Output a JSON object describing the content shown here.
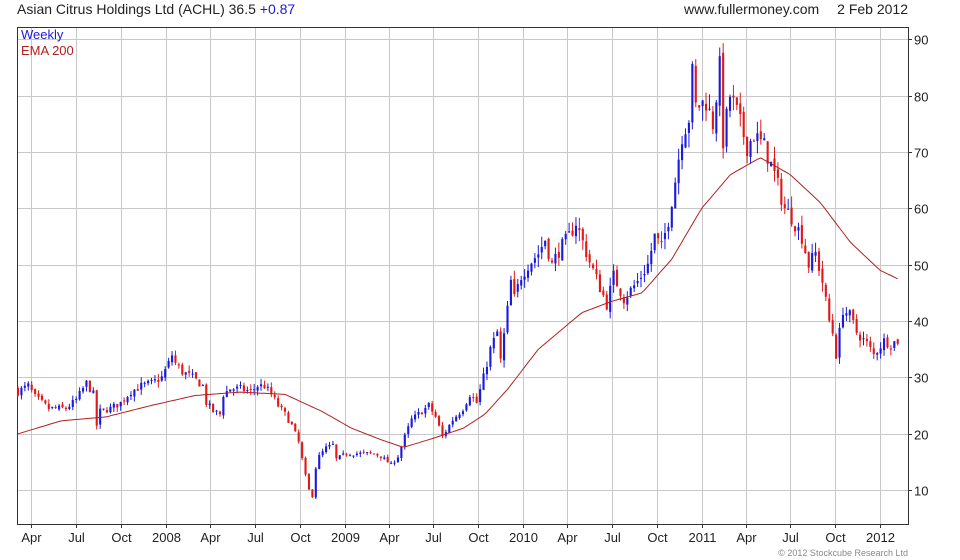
{
  "header": {
    "instrument": "Asian Citrus Holdings Ltd (ACHL)",
    "price": "36.5",
    "change": "+0.87",
    "source": "www.fullermoney.com",
    "date": "2 Feb 2012"
  },
  "copyright": "© 2012 Stockcube Research Ltd",
  "colors": {
    "up": "#1a1adb",
    "down": "#e01818",
    "ema": "#b02020",
    "grid": "#c8c8c8",
    "axis": "#333333"
  },
  "chart_data": {
    "type": "candlestick",
    "title": "Asian Citrus Holdings Ltd (ACHL)",
    "frequency": "Weekly",
    "overlay": "EMA 200",
    "ylim": [
      4,
      92
    ],
    "yticks": [
      10,
      20,
      30,
      40,
      50,
      60,
      70,
      80,
      90
    ],
    "y_axis_side": "right",
    "grid": true,
    "legend_position": "top-left",
    "xlim": [
      "2007-03-05",
      "2012-02-27"
    ],
    "xticks": [
      {
        "date": "2007-04-01",
        "label": "Apr"
      },
      {
        "date": "2007-07-01",
        "label": "Jul"
      },
      {
        "date": "2007-10-01",
        "label": "Oct"
      },
      {
        "date": "2008-01-01",
        "label": "2008"
      },
      {
        "date": "2008-04-01",
        "label": "Apr"
      },
      {
        "date": "2008-07-01",
        "label": "Jul"
      },
      {
        "date": "2008-10-01",
        "label": "Oct"
      },
      {
        "date": "2009-01-01",
        "label": "2009"
      },
      {
        "date": "2009-04-01",
        "label": "Apr"
      },
      {
        "date": "2009-07-01",
        "label": "Jul"
      },
      {
        "date": "2009-10-01",
        "label": "Oct"
      },
      {
        "date": "2010-01-01",
        "label": "2010"
      },
      {
        "date": "2010-04-01",
        "label": "Apr"
      },
      {
        "date": "2010-07-01",
        "label": "Jul"
      },
      {
        "date": "2010-10-01",
        "label": "Oct"
      },
      {
        "date": "2011-01-01",
        "label": "2011"
      },
      {
        "date": "2011-04-01",
        "label": "Apr"
      },
      {
        "date": "2011-07-01",
        "label": "Jul"
      },
      {
        "date": "2011-10-01",
        "label": "Oct"
      },
      {
        "date": "2012-01-01",
        "label": "2012"
      }
    ],
    "close_anchors": [
      [
        "2007-03-05",
        27.5
      ],
      [
        "2007-03-26",
        28.5
      ],
      [
        "2007-04-09",
        26.5
      ],
      [
        "2007-04-23",
        25.5
      ],
      [
        "2007-05-07",
        24.5
      ],
      [
        "2007-05-21",
        24.5
      ],
      [
        "2007-06-11",
        24.5
      ],
      [
        "2007-07-02",
        26.0
      ],
      [
        "2007-07-16",
        28.0
      ],
      [
        "2007-07-23",
        29.0
      ],
      [
        "2007-08-06",
        27.0
      ],
      [
        "2007-08-13",
        21.5
      ],
      [
        "2007-08-20",
        24.0
      ],
      [
        "2007-09-10",
        24.5
      ],
      [
        "2007-10-01",
        25.5
      ],
      [
        "2007-10-22",
        27.5
      ],
      [
        "2007-11-12",
        28.5
      ],
      [
        "2007-12-03",
        29.0
      ],
      [
        "2007-12-24",
        30.0
      ],
      [
        "2008-01-07",
        32.5
      ],
      [
        "2008-01-14",
        34.0
      ],
      [
        "2008-01-21",
        32.5
      ],
      [
        "2008-02-04",
        31.0
      ],
      [
        "2008-02-25",
        30.0
      ],
      [
        "2008-03-17",
        28.5
      ],
      [
        "2008-03-24",
        25.5
      ],
      [
        "2008-04-07",
        24.0
      ],
      [
        "2008-04-21",
        23.5
      ],
      [
        "2008-04-28",
        27.0
      ],
      [
        "2008-05-12",
        28.0
      ],
      [
        "2008-06-02",
        28.0
      ],
      [
        "2008-06-23",
        27.5
      ],
      [
        "2008-07-07",
        28.5
      ],
      [
        "2008-07-21",
        28.5
      ],
      [
        "2008-08-04",
        27.0
      ],
      [
        "2008-08-18",
        25.0
      ],
      [
        "2008-09-01",
        23.5
      ],
      [
        "2008-09-15",
        21.5
      ],
      [
        "2008-09-29",
        18.5
      ],
      [
        "2008-10-13",
        12.5
      ],
      [
        "2008-10-20",
        10.0
      ],
      [
        "2008-10-27",
        9.0
      ],
      [
        "2008-11-03",
        14.0
      ],
      [
        "2008-11-10",
        16.0
      ],
      [
        "2008-11-24",
        17.5
      ],
      [
        "2008-12-08",
        18.0
      ],
      [
        "2008-12-15",
        15.5
      ],
      [
        "2009-01-05",
        16.5
      ],
      [
        "2009-02-02",
        16.5
      ],
      [
        "2009-03-02",
        16.5
      ],
      [
        "2009-03-16",
        16.0
      ],
      [
        "2009-04-06",
        14.5
      ],
      [
        "2009-04-20",
        16.0
      ],
      [
        "2009-05-04",
        19.5
      ],
      [
        "2009-05-18",
        22.5
      ],
      [
        "2009-06-08",
        24.0
      ],
      [
        "2009-06-22",
        25.0
      ],
      [
        "2009-07-06",
        23.0
      ],
      [
        "2009-07-20",
        19.5
      ],
      [
        "2009-08-10",
        22.5
      ],
      [
        "2009-08-31",
        24.5
      ],
      [
        "2009-09-14",
        27.0
      ],
      [
        "2009-09-28",
        25.5
      ],
      [
        "2009-10-12",
        30.0
      ],
      [
        "2009-10-26",
        35.0
      ],
      [
        "2009-11-09",
        38.0
      ],
      [
        "2009-11-16",
        33.0
      ],
      [
        "2009-11-30",
        42.0
      ],
      [
        "2009-12-07",
        47.0
      ],
      [
        "2009-12-14",
        44.0
      ],
      [
        "2009-12-28",
        48.0
      ],
      [
        "2010-01-11",
        50.0
      ],
      [
        "2010-02-01",
        52.0
      ],
      [
        "2010-02-15",
        54.5
      ],
      [
        "2010-03-01",
        50.0
      ],
      [
        "2010-03-15",
        52.5
      ],
      [
        "2010-04-05",
        55.0
      ],
      [
        "2010-04-19",
        57.5
      ],
      [
        "2010-05-03",
        54.0
      ],
      [
        "2010-05-17",
        50.5
      ],
      [
        "2010-06-07",
        46.0
      ],
      [
        "2010-06-21",
        43.0
      ],
      [
        "2010-07-05",
        48.0
      ],
      [
        "2010-07-26",
        44.0
      ],
      [
        "2010-08-09",
        45.5
      ],
      [
        "2010-08-23",
        47.0
      ],
      [
        "2010-09-13",
        50.0
      ],
      [
        "2010-09-27",
        55.0
      ],
      [
        "2010-10-11",
        53.0
      ],
      [
        "2010-10-25",
        58.0
      ],
      [
        "2010-11-08",
        65.0
      ],
      [
        "2010-11-22",
        73.0
      ],
      [
        "2010-12-06",
        76.0
      ],
      [
        "2010-12-13",
        84.0
      ],
      [
        "2010-12-20",
        78.0
      ],
      [
        "2011-01-10",
        79.0
      ],
      [
        "2011-01-24",
        75.0
      ],
      [
        "2011-02-07",
        85.0
      ],
      [
        "2011-02-14",
        72.0
      ],
      [
        "2011-02-28",
        80.0
      ],
      [
        "2011-03-14",
        77.0
      ],
      [
        "2011-04-04",
        71.0
      ],
      [
        "2011-04-18",
        73.0
      ],
      [
        "2011-05-09",
        71.0
      ],
      [
        "2011-05-30",
        66.0
      ],
      [
        "2011-06-20",
        60.0
      ],
      [
        "2011-07-04",
        58.5
      ],
      [
        "2011-07-25",
        55.0
      ],
      [
        "2011-08-08",
        50.0
      ],
      [
        "2011-08-22",
        52.0
      ],
      [
        "2011-09-05",
        47.0
      ],
      [
        "2011-09-19",
        40.0
      ],
      [
        "2011-09-26",
        38.0
      ],
      [
        "2011-10-03",
        34.0
      ],
      [
        "2011-10-17",
        42.0
      ],
      [
        "2011-10-31",
        41.0
      ],
      [
        "2011-11-14",
        38.0
      ],
      [
        "2011-12-05",
        36.0
      ],
      [
        "2011-12-19",
        34.0
      ],
      [
        "2012-01-09",
        36.5
      ],
      [
        "2012-01-23",
        36.0
      ],
      [
        "2012-02-06",
        36.5
      ]
    ],
    "ema200_anchors": [
      [
        "2007-03-05",
        20.0
      ],
      [
        "2007-06-01",
        22.3
      ],
      [
        "2007-09-01",
        23.0
      ],
      [
        "2007-12-01",
        25.0
      ],
      [
        "2008-03-01",
        26.8
      ],
      [
        "2008-06-01",
        27.4
      ],
      [
        "2008-09-01",
        27.0
      ],
      [
        "2008-11-15",
        24.0
      ],
      [
        "2009-01-15",
        21.0
      ],
      [
        "2009-03-15",
        19.0
      ],
      [
        "2009-05-01",
        17.6
      ],
      [
        "2009-07-01",
        19.2
      ],
      [
        "2009-09-01",
        21.0
      ],
      [
        "2009-10-15",
        23.5
      ],
      [
        "2009-12-01",
        28.0
      ],
      [
        "2010-02-01",
        35.0
      ],
      [
        "2010-05-01",
        41.5
      ],
      [
        "2010-07-01",
        43.5
      ],
      [
        "2010-09-01",
        45.0
      ],
      [
        "2010-11-01",
        51.0
      ],
      [
        "2011-01-01",
        60.0
      ],
      [
        "2011-03-01",
        66.0
      ],
      [
        "2011-05-01",
        69.0
      ],
      [
        "2011-07-01",
        66.0
      ],
      [
        "2011-09-01",
        61.0
      ],
      [
        "2011-11-01",
        54.0
      ],
      [
        "2012-01-01",
        49.0
      ],
      [
        "2012-02-06",
        47.5
      ]
    ]
  }
}
